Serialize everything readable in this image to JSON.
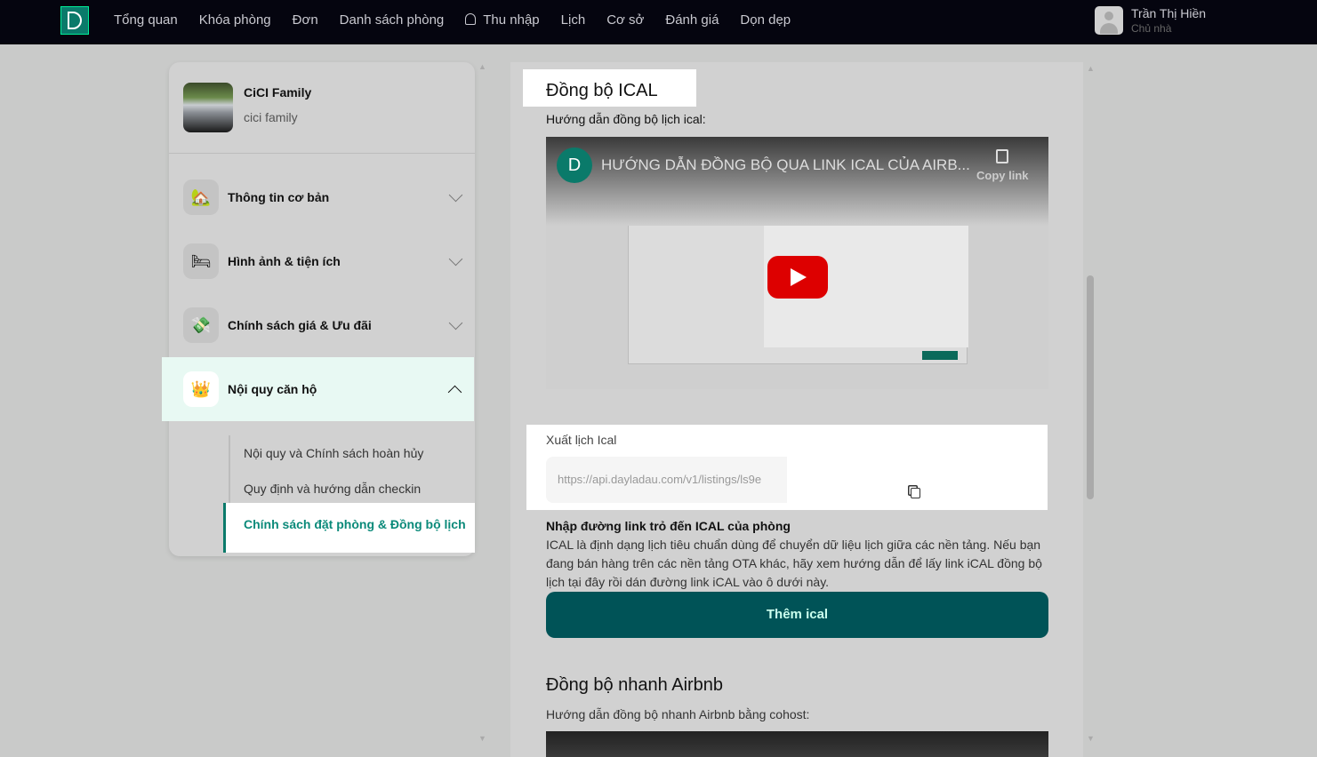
{
  "nav": {
    "items": [
      "Tổng quan",
      "Khóa phòng",
      "Đơn",
      "Danh sách phòng",
      "Thu nhập",
      "Lịch",
      "Cơ sở",
      "Đánh giá",
      "Dọn dẹp"
    ],
    "user": {
      "name": "Trần Thị Hiền",
      "role": "Chủ nhà"
    }
  },
  "sidebar": {
    "property": {
      "name": "CiCI Family",
      "subtitle": "cici family"
    },
    "sections": [
      {
        "label": "Thông tin cơ bản",
        "icon": "🏡"
      },
      {
        "label": "Hình ảnh & tiện ích",
        "icon": "🛏"
      },
      {
        "label": "Chính sách giá & Ưu đãi",
        "icon": "💸"
      },
      {
        "label": "Nội quy căn hộ",
        "icon": "👑"
      }
    ],
    "subitems": [
      "Nội quy và Chính sách hoàn hủy",
      "Quy định và hướng dẫn checkin",
      "Chính sách đặt phòng & Đồng bộ lịch"
    ]
  },
  "main": {
    "ical_title": "Đồng bộ ICAL",
    "ical_guide": "Hướng dẫn đồng bộ lịch ical:",
    "video": {
      "title": "HƯỚNG DẪN ĐỒNG BỘ QUA LINK ICAL CỦA AIRB...",
      "copy": "Copy link"
    },
    "export": {
      "label": "Xuất lịch Ical",
      "value": "https://api.dayladau.com/v1/listings/ls9e"
    },
    "import": {
      "title": "Nhập đường link trỏ đến ICAL của phòng",
      "desc": "ICAL là định dạng lịch tiêu chuẩn dùng để chuyển dữ liệu lịch giữa các nền tảng. Nếu bạn đang bán hàng trên các nền tảng OTA khác, hãy xem hướng dẫn để lấy link iCAL đồng bộ lịch tại đây rồi dán đường link iCAL vào ô dưới này.",
      "button": "Thêm ical"
    },
    "airbnb_title": "Đồng bộ nhanh Airbnb",
    "airbnb_guide": "Hướng dẫn đồng bộ nhanh Airbnb bằng cohost:"
  },
  "colors": {
    "brand": "#005357",
    "accent": "#0b8a7a",
    "nav_bg": "#05050f"
  }
}
